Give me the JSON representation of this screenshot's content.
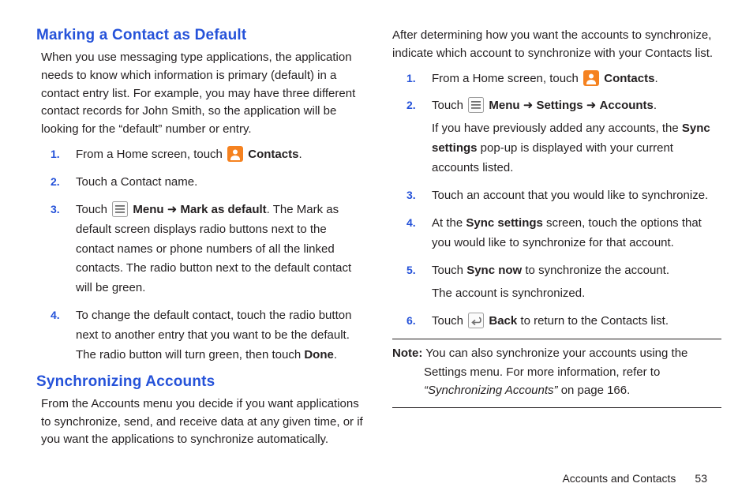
{
  "left": {
    "h_default": "Marking a Contact as Default",
    "intro_default": "When you use messaging type applications, the application needs to know which information is primary (default) in a contact entry list. For example, you may have three different contact records for John Smith, so the application will be looking for the “default” number or entry.",
    "d1_a": "From a Home screen, touch ",
    "d1_b": "Contacts",
    "d1_c": ".",
    "d2": "Touch a Contact name.",
    "d3_a": "Touch ",
    "d3_b": "Menu",
    "d3_c": " ➜ ",
    "d3_d": "Mark as default",
    "d3_e": ". The Mark as default screen displays radio buttons next to the contact names or phone numbers of all the linked contacts. The radio button next to the default contact will be green.",
    "d4_a": "To change the default contact, touch the radio button next to another entry that you want to be the default. The radio button will turn green, then touch ",
    "d4_b": "Done",
    "d4_c": ".",
    "h_sync": "Synchronizing Accounts",
    "intro_sync": "From the Accounts menu you decide if you want applications to synchronize, send, and receive data at any given time, or if you want the applications to synchronize automatically."
  },
  "right": {
    "intro": "After determining how you want the accounts to synchronize, indicate which account to synchronize with your Contacts list.",
    "s1_a": "From a Home screen, touch ",
    "s1_b": "Contacts",
    "s1_c": ".",
    "s2_a": "Touch ",
    "s2_b": "Menu",
    "s2_c": " ➜ ",
    "s2_d": "Settings",
    "s2_e": " ➜ ",
    "s2_f": "Accounts",
    "s2_g": ".",
    "s2_h": "If you have previously added any accounts, the ",
    "s2_i": "Sync settings",
    "s2_j": " pop-up is displayed with your current accounts listed.",
    "s3": "Touch an account that you would like to synchronize.",
    "s4_a": "At the ",
    "s4_b": "Sync settings",
    "s4_c": " screen, touch the options that you would like to synchronize for that account.",
    "s5_a": "Touch ",
    "s5_b": "Sync now",
    "s5_c": " to synchronize the account.",
    "s5_d": "The account is synchronized.",
    "s6_a": "Touch ",
    "s6_b": "Back",
    "s6_c": " to return to the Contacts list.",
    "note_lbl": "Note:",
    "note_a": " You can also synchronize your accounts using the Settings menu. For more information, refer to ",
    "note_b": "“Synchronizing Accounts”",
    "note_c": " on page 166."
  },
  "footer": {
    "section": "Accounts and Contacts",
    "page": "53"
  }
}
